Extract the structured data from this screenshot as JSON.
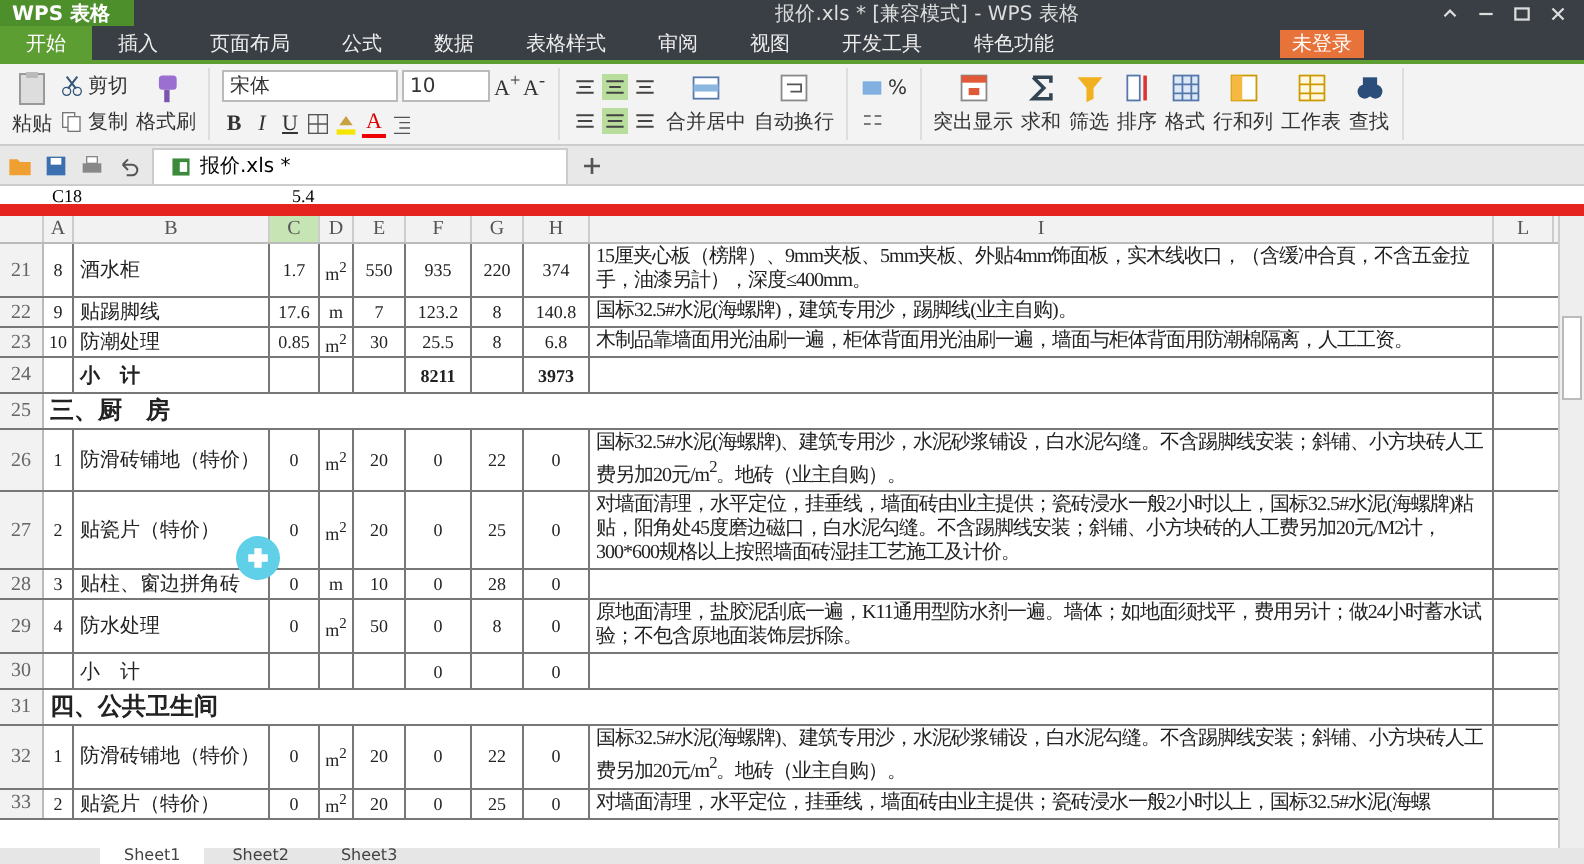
{
  "window": {
    "app": "WPS 表格",
    "title": "报价.xls * [兼容模式] - WPS 表格"
  },
  "menu": [
    {
      "label": "开始",
      "selected": true
    },
    {
      "label": "插入",
      "selected": false
    },
    {
      "label": "页面布局",
      "selected": false
    },
    {
      "label": "公式",
      "selected": false
    },
    {
      "label": "数据",
      "selected": false
    },
    {
      "label": "表格样式",
      "selected": false
    },
    {
      "label": "审阅",
      "selected": false
    },
    {
      "label": "视图",
      "selected": false
    },
    {
      "label": "开发工具",
      "selected": false
    },
    {
      "label": "特色功能",
      "selected": false
    }
  ],
  "login": "未登录",
  "ribbon": {
    "paste": "粘贴",
    "cut": "剪切",
    "copy": "复制",
    "painter": "格式刷",
    "font": "宋体",
    "size": "10",
    "grow": "A$^{+}$",
    "shrink": "A$^{-}$",
    "styles": [
      "B",
      "I",
      "U"
    ],
    "color_letter": "A",
    "merge": "合并居中",
    "wrap": "自动换行",
    "percent": "%",
    "tools": [
      "突出显示",
      "求和",
      "筛选",
      "排序",
      "格式",
      "行和列",
      "工作表",
      "查找"
    ]
  },
  "doc_tabs": [
    {
      "label": "报价.xls *",
      "selected": true
    }
  ],
  "formula_bar": {
    "cell": "C18",
    "value": "5.4"
  },
  "columns": [
    {
      "label": "A",
      "selected": false
    },
    {
      "label": "B",
      "selected": false
    },
    {
      "label": "C",
      "selected": true
    },
    {
      "label": "D",
      "selected": false
    },
    {
      "label": "E",
      "selected": false
    },
    {
      "label": "F",
      "selected": false
    },
    {
      "label": "G",
      "selected": false
    },
    {
      "label": "H",
      "selected": false
    },
    {
      "label": "I",
      "selected": false
    },
    {
      "label": "L",
      "selected": false
    }
  ],
  "rows": [
    {
      "kind": "item",
      "num": "21",
      "a": "8",
      "b": "酒水柜",
      "c": "1.7",
      "d": "m$^{2}$",
      "e": "550",
      "f": "935",
      "g": "220",
      "h": "374",
      "i": "15厘夹心板（榜牌）、9mm夹板、5mm夹板、外贴4mm饰面板，实木线收口，（含缓冲合頁，不含五金拉手，油漆另計），深度≤400mm。"
    },
    {
      "kind": "item",
      "num": "22",
      "a": "9",
      "b": "贴踢脚线",
      "c": "17.6",
      "d": "m",
      "e": "7",
      "f": "123.2",
      "g": "8",
      "h": "140.8",
      "i": "国标32.5#水泥(海螺牌)，建筑专用沙，踢脚线(业主自购)。"
    },
    {
      "kind": "item",
      "num": "23",
      "a": "10",
      "b": "防潮处理",
      "c": "0.85",
      "d": "m$^{2}$",
      "e": "30",
      "f": "25.5",
      "g": "8",
      "h": "6.8",
      "i": "木制品靠墙面用光油刷一遍，柜体背面用光油刷一遍，墙面与柜体背面用防潮棉隔离，人工工资。"
    },
    {
      "kind": "subtotal",
      "bold": true,
      "num": "24",
      "b": "小　计",
      "f": "8211",
      "h": "3973"
    },
    {
      "kind": "section",
      "num": "25",
      "title": "三、厨　房"
    },
    {
      "kind": "item",
      "num": "26",
      "a": "1",
      "b": "防滑砖铺地（特价）",
      "c": "0",
      "d": "m$^{2}$",
      "e": "20",
      "f": "0",
      "g": "22",
      "h": "0",
      "i": "国标32.5#水泥(海螺牌)、建筑专用沙，水泥砂浆铺设，白水泥勾缝。不含踢脚线安装；斜铺、小方块砖人工费另加20元/m$^{2}$。地砖（业主自购）。"
    },
    {
      "kind": "item",
      "num": "27",
      "a": "2",
      "b": "贴瓷片（特价）",
      "c": "0",
      "d": "m$^{2}$",
      "e": "20",
      "f": "0",
      "g": "25",
      "h": "0",
      "i": "对墙面清理，水平定位，挂垂线，墙面砖由业主提供；瓷砖浸水一般2小时以上，国标32.5#水泥(海螺牌)粘贴，阳角处45度磨边磁口，白水泥勾缝。不含踢脚线安装；斜铺、小方块砖的人工费另加20元/M2计，300*600规格以上按照墙面砖湿挂工艺施工及计价。"
    },
    {
      "kind": "item",
      "num": "28",
      "a": "3",
      "b": "贴柱、窗边拼角砖",
      "c": "0",
      "d": "m",
      "e": "10",
      "f": "0",
      "g": "28",
      "h": "0"
    },
    {
      "kind": "item",
      "num": "29",
      "a": "4",
      "b": "防水处理",
      "c": "0",
      "d": "m$^{2}$",
      "e": "50",
      "f": "0",
      "g": "8",
      "h": "0",
      "i": "原地面清理，盐胶泥刮底一遍，K11通用型防水剂一遍。墙体；如地面须找平，费用另计；做24小时蓄水试验；不包含原地面装饰层拆除。"
    },
    {
      "kind": "subtotal",
      "bold": false,
      "num": "30",
      "b": "小　计",
      "f": "0",
      "h": "0"
    },
    {
      "kind": "section",
      "num": "31",
      "title": "四、公共卫生间"
    },
    {
      "kind": "item",
      "num": "32",
      "a": "1",
      "b": "防滑砖铺地（特价）",
      "c": "0",
      "d": "m$^{2}$",
      "e": "20",
      "f": "0",
      "g": "22",
      "h": "0",
      "i": "国标32.5#水泥(海螺牌)、建筑专用沙，水泥砂浆铺设，白水泥勾缝。不含踢脚线安装；斜铺、小方块砖人工费另加20元/m$^{2}$。地砖（业主自购）。"
    },
    {
      "kind": "item",
      "num": "33",
      "a": "2",
      "b": "贴瓷片（特价）",
      "c": "0",
      "d": "m$^{2}$",
      "e": "20",
      "f": "0",
      "g": "25",
      "h": "0",
      "i": "对墙面清理，水平定位，挂垂线，墙面砖由业主提供；瓷砖浸水一般2小时以上，国标32.5#水泥(海螺"
    }
  ],
  "sheets": [
    {
      "label": "Sheet1",
      "selected": true
    },
    {
      "label": "Sheet2",
      "selected": false
    },
    {
      "label": "Sheet3",
      "selected": false
    }
  ]
}
